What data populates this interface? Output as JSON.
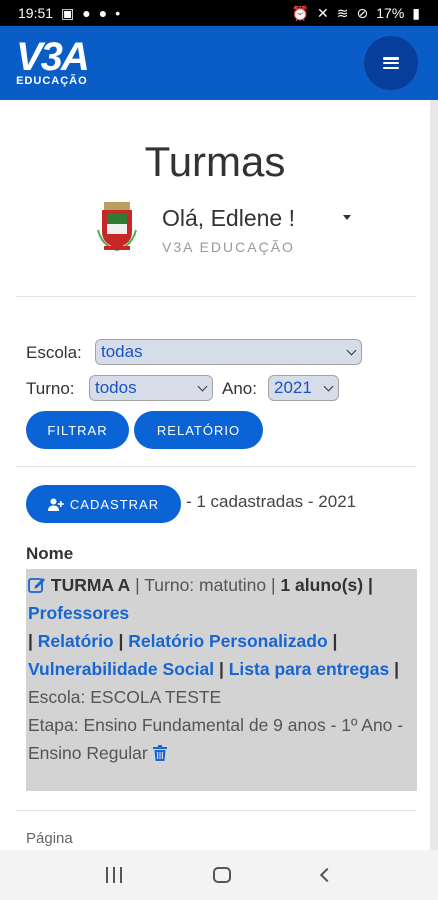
{
  "status_bar": {
    "time": "19:51",
    "battery": "17%"
  },
  "header": {
    "logo_text": "V3A",
    "logo_subtitle": "EDUCAÇÃO"
  },
  "page": {
    "title": "Turmas",
    "greeting": "Olá, Edlene !",
    "organization": "V3A EDUCAÇÃO"
  },
  "filters": {
    "escola_label": "Escola:",
    "escola_value": "todas",
    "turno_label": "Turno:",
    "turno_value": "todos",
    "ano_label": "Ano:",
    "ano_value": "2021",
    "filtrar_label": "FILTRAR",
    "relatorio_label": "RELATÓRIO"
  },
  "actions": {
    "cadastrar_label": "CADASTRAR",
    "count_text": "- 1 cadastradas - 2021"
  },
  "table": {
    "column_header": "Nome",
    "turma": {
      "name": "TURMA A",
      "turno": "| Turno: matutino |",
      "alunos": "1 aluno(s)",
      "sep1": "|",
      "professores": "Professores",
      "sep2": "|",
      "relatorio": "Relatório",
      "sep3": "|",
      "relatorio_personalizado": "Relatório Personalizado",
      "sep4": "|",
      "vulnerabilidade": "Vulnerabilidade Social",
      "sep5": "|",
      "lista": "Lista para entregas",
      "sep6": "|",
      "escola": "Escola: ESCOLA TESTE",
      "etapa": "Etapa: Ensino Fundamental de 9 anos - 1º Ano - Ensino Regular"
    }
  },
  "pagination": {
    "label": "Página"
  },
  "icons": {
    "menu": "hamburger-icon",
    "edit": "edit-icon",
    "trash": "trash-icon",
    "user_add": "user-plus-icon"
  },
  "colors": {
    "brand_blue": "#0a5cc7",
    "link_blue": "#1766d1",
    "card_gray": "#d3d3d3"
  }
}
